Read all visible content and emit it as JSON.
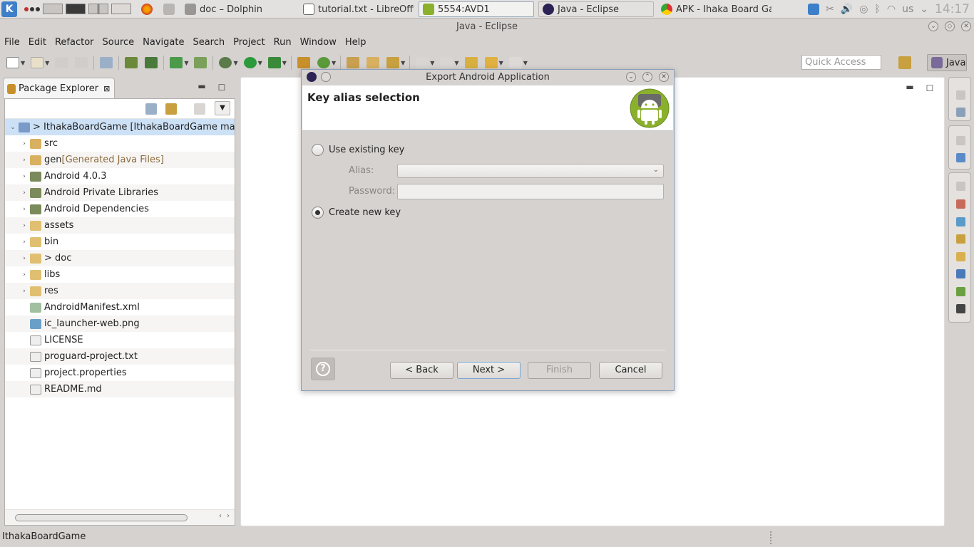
{
  "taskbar": {
    "tasks": [
      {
        "label": "doc – Dolphin"
      },
      {
        "label": "tutorial.txt - LibreOffic"
      },
      {
        "label": "5554:AVD1"
      },
      {
        "label": "Java - Eclipse"
      },
      {
        "label": "APK - Ihaka Board Gam"
      }
    ],
    "keyboard_layout": "us",
    "clock": "14:17"
  },
  "window": {
    "title": "Java - Eclipse"
  },
  "menubar": {
    "items": [
      "File",
      "Edit",
      "Refactor",
      "Source",
      "Navigate",
      "Search",
      "Project",
      "Run",
      "Window",
      "Help"
    ]
  },
  "toolbar": {
    "quick_access_placeholder": "Quick Access",
    "perspective_label": "Java"
  },
  "package_explorer": {
    "tab_label": "Package Explorer",
    "tree": [
      {
        "label": "> IthakaBoardGame  [IthakaBoardGame master",
        "decoration": "",
        "icon": "project-icon",
        "expand": "expanded",
        "indent": 0
      },
      {
        "label": "src",
        "decoration": "",
        "icon": "source-folder-icon",
        "expand": "collapsed",
        "indent": 1
      },
      {
        "label": "gen",
        "decoration": " [Generated Java Files]",
        "icon": "source-folder-icon",
        "expand": "collapsed",
        "indent": 1
      },
      {
        "label": "Android 4.0.3",
        "decoration": "",
        "icon": "library-icon",
        "expand": "collapsed",
        "indent": 1
      },
      {
        "label": "Android Private Libraries",
        "decoration": "",
        "icon": "library-icon",
        "expand": "collapsed",
        "indent": 1
      },
      {
        "label": "Android Dependencies",
        "decoration": "",
        "icon": "library-icon",
        "expand": "collapsed",
        "indent": 1
      },
      {
        "label": "assets",
        "decoration": "",
        "icon": "folder-icon",
        "expand": "collapsed",
        "indent": 1
      },
      {
        "label": "bin",
        "decoration": "",
        "icon": "folder-icon",
        "expand": "collapsed",
        "indent": 1
      },
      {
        "label": "> doc",
        "decoration": "",
        "icon": "folder-icon",
        "expand": "collapsed",
        "indent": 1
      },
      {
        "label": "libs",
        "decoration": "",
        "icon": "folder-icon",
        "expand": "collapsed",
        "indent": 1
      },
      {
        "label": "res",
        "decoration": "",
        "icon": "folder-icon",
        "expand": "collapsed",
        "indent": 1
      },
      {
        "label": "AndroidManifest.xml",
        "decoration": "",
        "icon": "xml-file-icon",
        "expand": "none",
        "indent": 1
      },
      {
        "label": "ic_launcher-web.png",
        "decoration": "",
        "icon": "image-file-icon",
        "expand": "none",
        "indent": 1
      },
      {
        "label": "LICENSE",
        "decoration": "",
        "icon": "text-file-icon",
        "expand": "none",
        "indent": 1
      },
      {
        "label": "proguard-project.txt",
        "decoration": "",
        "icon": "text-file-icon",
        "expand": "none",
        "indent": 1
      },
      {
        "label": "project.properties",
        "decoration": "",
        "icon": "text-file-icon",
        "expand": "none",
        "indent": 1
      },
      {
        "label": "README.md",
        "decoration": "",
        "icon": "text-file-icon",
        "expand": "none",
        "indent": 1
      }
    ]
  },
  "statusbar": {
    "text": "IthakaBoardGame"
  },
  "dialog": {
    "title": "Export Android Application",
    "heading": "Key alias selection",
    "use_existing_label": "Use existing key",
    "alias_label": "Alias:",
    "alias_value": "",
    "password_label": "Password:",
    "password_value": "",
    "create_new_label": "Create new key",
    "selected_option": "Create new key",
    "buttons": {
      "back": "< Back",
      "next": "Next >",
      "finish": "Finish",
      "cancel": "Cancel"
    }
  },
  "colors": {
    "selection": "#cde1f6",
    "android_green": "#8ab02c",
    "default_button_border": "#7aa6d6"
  }
}
